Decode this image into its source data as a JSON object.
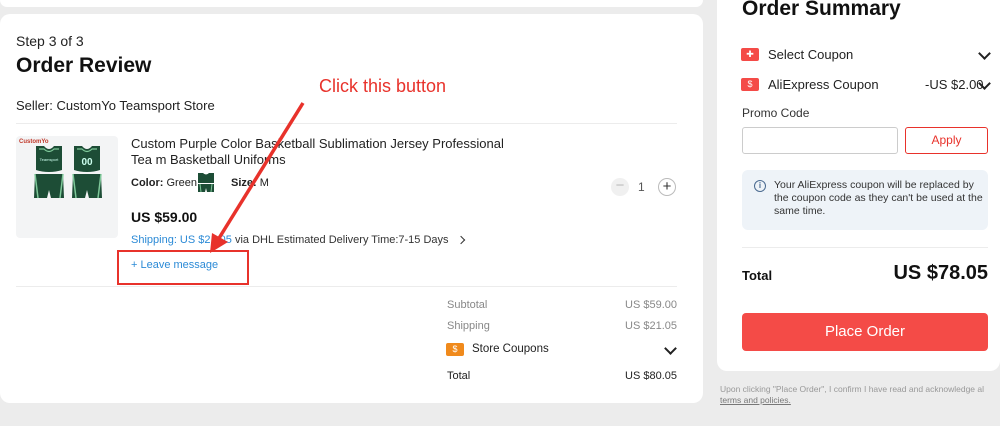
{
  "checkout": {
    "step": "Step 3 of 3",
    "title": "Order Review",
    "seller": "Seller: CustomYo Teamsport Store"
  },
  "product": {
    "title": "Custom Purple Color Basketball Sublimation Jersey Professional Tea m Basketball Uniforms",
    "color_label": "Color:",
    "color_value": "Green",
    "size_label": "Size:",
    "size_value": "M",
    "price": "US $59.00",
    "shipping_link": "Shipping: US $21.05",
    "shipping_rest": "via DHL  Estimated Delivery Time:7-15 Days",
    "leave_message": "+ Leave message",
    "quantity": "1",
    "thumb_brand": "CustomYo",
    "jersey_number": "00",
    "jersey_team": "Teamsport"
  },
  "annotation": {
    "text": "Click this button",
    "color": "#e8322b"
  },
  "store_summary": {
    "subtotal_label": "Subtotal",
    "subtotal_value": "US $59.00",
    "shipping_label": "Shipping",
    "shipping_value": "US $21.05",
    "coupons_label": "Store Coupons",
    "total_label": "Total",
    "total_value": "US $80.05"
  },
  "order_summary": {
    "title": "Order Summary",
    "select_coupon": "Select Coupon",
    "ae_coupon": "AliExpress Coupon",
    "ae_coupon_value": "-US $2.00",
    "promo_label": "Promo Code",
    "promo_placeholder": "",
    "apply_label": "Apply",
    "info": "Your AliExpress coupon will be replaced by the coupon code as they can't be used at the same time.",
    "total_label": "Total",
    "total_value": "US $78.05",
    "place_order": "Place Order",
    "disclaimer": "Upon clicking \"Place Order\", I confirm I have read and acknowledge al",
    "disclaimer_link": "terms and policies."
  },
  "colors": {
    "accent": "#f44b47",
    "link": "#2b8ad6",
    "annotation": "#e8322b",
    "coupon_icon": "#f08a1c"
  },
  "icons": [
    "coupon-icon",
    "info-icon",
    "chevron-down-icon",
    "chevron-right-icon",
    "minus-icon",
    "plus-icon"
  ]
}
